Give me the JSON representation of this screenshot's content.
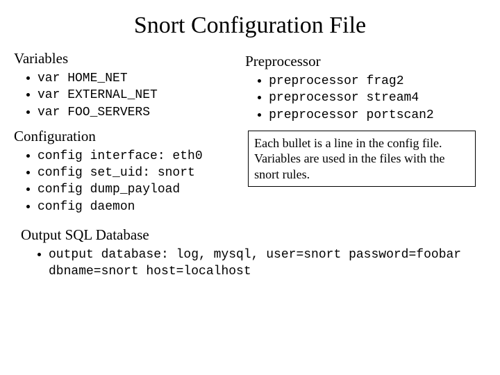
{
  "title": "Snort Configuration File",
  "left": {
    "variables": {
      "heading": "Variables",
      "items": [
        "var HOME_NET",
        "var EXTERNAL_NET",
        "var FOO_SERVERS"
      ]
    },
    "configuration": {
      "heading": "Configuration",
      "items": [
        "config interface: eth0",
        "config set_uid: snort",
        "config dump_payload",
        "config daemon"
      ]
    }
  },
  "right": {
    "preprocessor": {
      "heading": "Preprocessor",
      "items": [
        "preprocessor frag2",
        "preprocessor stream4",
        "preprocessor portscan2"
      ]
    },
    "note": "Each bullet is a line in the config file.  Variables are used in the files with the snort rules."
  },
  "output": {
    "heading": "Output SQL Database",
    "items": [
      "output database: log, mysql, user=snort password=foobar dbname=snort host=localhost"
    ]
  }
}
